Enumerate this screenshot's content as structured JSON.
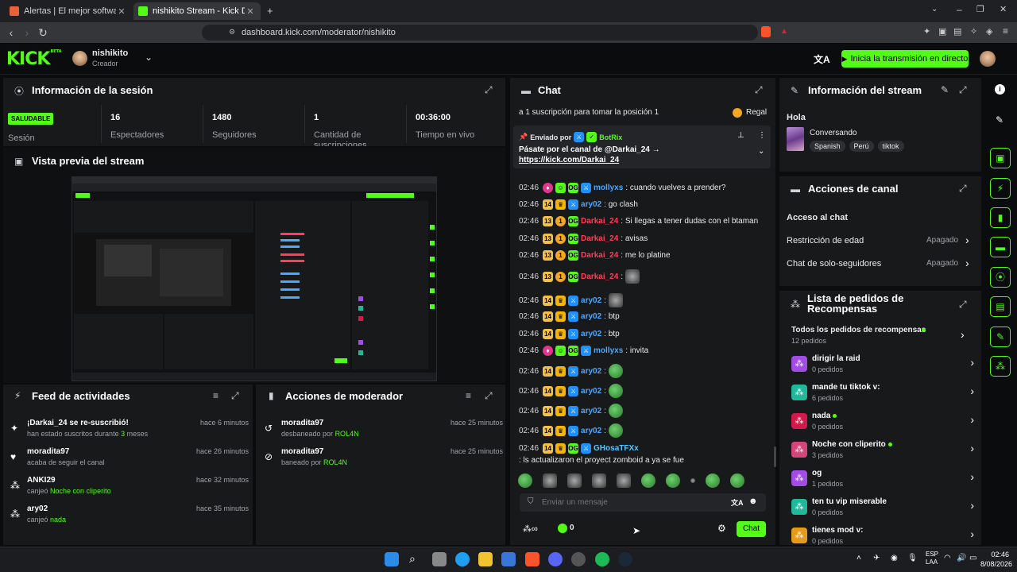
{
  "browser": {
    "tabs": [
      {
        "label": "Alertas | El mejor software para potenciar tu stream"
      },
      {
        "label": "nishikito Stream - Kick Dashboard"
      }
    ],
    "url": "dashboard.kick.com/moderator/nishikito"
  },
  "header": {
    "logo": "KICK",
    "logo_sup": "BETA",
    "username": "nishikito",
    "role": "Creador",
    "live_button": "Inicia la transmisión en directo"
  },
  "session": {
    "title": "Información de la sesión",
    "status": "SALUDABLE",
    "status_label": "Sesión",
    "stats": [
      {
        "value": "16",
        "label": "Espectadores"
      },
      {
        "value": "1480",
        "label": "Seguidores"
      },
      {
        "value": "1",
        "label": "Cantidad de suscripciones"
      },
      {
        "value": "00:36:00",
        "label": "Tiempo en vivo"
      }
    ]
  },
  "preview": {
    "title": "Vista previa del stream"
  },
  "feed": {
    "title": "Feed de actividades",
    "items": [
      {
        "title": "¡Darkai_24 se re-suscribió!",
        "sub": "han estado suscritos durante ",
        "highlight": "3",
        "sub_after": " meses",
        "time": "hace 6 minutos"
      },
      {
        "title": "moradita97",
        "sub": "acaba de seguir el canal",
        "highlight": "",
        "sub_after": "",
        "time": "hace 26 minutos"
      },
      {
        "title": "ANKI29",
        "sub": "canjeó ",
        "highlight": "Noche con cliperito",
        "sub_after": "",
        "time": "hace 32 minutos"
      },
      {
        "title": "ary02",
        "sub": "canjeó ",
        "highlight": "nada",
        "sub_after": "",
        "time": "hace 35 minutos"
      }
    ]
  },
  "modactions": {
    "title": "Acciones de moderador",
    "items": [
      {
        "title": "moradita97",
        "sub": "desbaneado por ",
        "by": "ROL4N",
        "time": "hace 25 minutos"
      },
      {
        "title": "moradita97",
        "sub": "baneado por ",
        "by": "ROL4N",
        "time": "hace 25 minutos"
      }
    ]
  },
  "chat": {
    "title": "Chat",
    "goal_text": "a 1 suscripción para tomar la posición 1",
    "goal_action": "Regal",
    "pinned": {
      "sent_by": "Enviado por",
      "author": "BotRix",
      "text": "Pásate por el canal de @Darkai_24 →",
      "link": "https://kick.com/Darkai_24"
    },
    "messages": [
      {
        "time": "02:46",
        "user": "mollyxs",
        "color": "blue",
        "text": ": cuando vuelves a prender?"
      },
      {
        "time": "02:46",
        "user": "ary02",
        "color": "blue",
        "text": ": go clash"
      },
      {
        "time": "02:46",
        "user": "Darkai_24",
        "color": "red",
        "text": ": Si llegas a tener dudas con el btaman"
      },
      {
        "time": "02:46",
        "user": "Darkai_24",
        "color": "red",
        "text": ": avisas"
      },
      {
        "time": "02:46",
        "user": "Darkai_24",
        "color": "red",
        "text": ": me lo platine"
      },
      {
        "time": "02:46",
        "user": "Darkai_24",
        "color": "red",
        "text": ":"
      },
      {
        "time": "02:46",
        "user": "ary02",
        "color": "blue",
        "text": ":"
      },
      {
        "time": "02:46",
        "user": "ary02",
        "color": "blue",
        "text": ": btp"
      },
      {
        "time": "02:46",
        "user": "ary02",
        "color": "blue",
        "text": ": btp"
      },
      {
        "time": "02:46",
        "user": "mollyxs",
        "color": "blue",
        "text": ": invita"
      },
      {
        "time": "02:46",
        "user": "ary02",
        "color": "blue",
        "text": ":"
      },
      {
        "time": "02:46",
        "user": "ary02",
        "color": "blue",
        "text": ":"
      },
      {
        "time": "02:46",
        "user": "ary02",
        "color": "blue",
        "text": ":"
      },
      {
        "time": "02:46",
        "user": "ary02",
        "color": "blue",
        "text": ":"
      },
      {
        "time": "02:46",
        "user": "GHosaTFXx",
        "color": "cyan",
        "text": ": ls actualizaron el proyect zomboid a ya se fue"
      }
    ],
    "input_placeholder": "Enviar un mensaje",
    "points": "0",
    "send_label": "Chat"
  },
  "stream_info": {
    "title": "Información del stream",
    "stream_title": "Hola",
    "category": "Conversando",
    "tags": [
      "Spanish",
      "Perú",
      "tiktok"
    ]
  },
  "channel_actions": {
    "title": "Acciones de canal",
    "subtitle": "Acceso al chat",
    "rows": [
      {
        "label": "Restricción de edad",
        "value": "Apagado"
      },
      {
        "label": "Chat de solo-seguidores",
        "value": "Apagado"
      }
    ]
  },
  "rewards": {
    "title": "Lista de pedidos de Recompensas",
    "all_label": "Todos los pedidos de recompensas",
    "all_count": "12 pedidos",
    "items": [
      {
        "name": "dirigir la raid",
        "count": "0 pedidos",
        "color": "#a24ce6",
        "dot": false
      },
      {
        "name": "mande tu tiktok v:",
        "count": "6 pedidos",
        "color": "#1fb89a",
        "dot": false
      },
      {
        "name": "nada",
        "count": "0 pedidos",
        "color": "#d11a4a",
        "dot": true
      },
      {
        "name": "Noche con cliperito",
        "count": "3 pedidos",
        "color": "#d6457a",
        "dot": true
      },
      {
        "name": "og",
        "count": "1 pedidos",
        "color": "#a24ce6",
        "dot": false
      },
      {
        "name": "ten tu vip miserable",
        "count": "0 pedidos",
        "color": "#1fb89a",
        "dot": false
      },
      {
        "name": "tienes mod v:",
        "count": "0 pedidos",
        "color": "#e59a1a",
        "dot": false
      }
    ]
  },
  "taskbar": {
    "lang": "ESP",
    "lang2": "LAA",
    "time": "02:46",
    "date": "8/08/2026"
  },
  "colors": {
    "accent": "#53fc18",
    "panel": "#18191b",
    "background": "#0b0c0d"
  }
}
